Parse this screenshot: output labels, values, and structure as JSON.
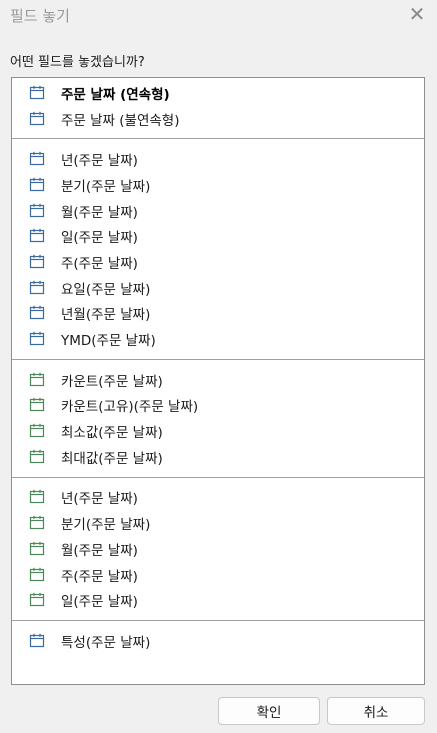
{
  "dialog": {
    "title": "필드 놓기",
    "prompt": "어떤 필드를 놓겠습니까?"
  },
  "colors": {
    "icon_blue": "#3a6b9e",
    "icon_green": "#4a8a5a",
    "bold_text": "#000000"
  },
  "groups": [
    {
      "items": [
        {
          "label": "주문 날짜 (연속형)",
          "icon": "calendar-icon",
          "icon_color": "blue",
          "bold": true
        },
        {
          "label": "주문 날짜 (불연속형)",
          "icon": "calendar-icon",
          "icon_color": "blue",
          "bold": false
        }
      ]
    },
    {
      "items": [
        {
          "label": "년(주문 날짜)",
          "icon": "calendar-icon",
          "icon_color": "blue"
        },
        {
          "label": "분기(주문 날짜)",
          "icon": "calendar-icon",
          "icon_color": "blue"
        },
        {
          "label": "월(주문 날짜)",
          "icon": "calendar-icon",
          "icon_color": "blue"
        },
        {
          "label": "일(주문 날짜)",
          "icon": "calendar-icon",
          "icon_color": "blue"
        },
        {
          "label": "주(주문 날짜)",
          "icon": "calendar-icon",
          "icon_color": "blue"
        },
        {
          "label": "요일(주문 날짜)",
          "icon": "calendar-icon",
          "icon_color": "blue"
        },
        {
          "label": "년월(주문 날짜)",
          "icon": "calendar-icon",
          "icon_color": "blue"
        },
        {
          "label": "YMD(주문 날짜)",
          "icon": "calendar-icon",
          "icon_color": "blue"
        }
      ]
    },
    {
      "items": [
        {
          "label": "카운트(주문 날짜)",
          "icon": "calendar-icon",
          "icon_color": "green"
        },
        {
          "label": "카운트(고유)(주문 날짜)",
          "icon": "calendar-icon",
          "icon_color": "green"
        },
        {
          "label": "최소값(주문 날짜)",
          "icon": "calendar-icon",
          "icon_color": "green"
        },
        {
          "label": "최대값(주문 날짜)",
          "icon": "calendar-icon",
          "icon_color": "green"
        }
      ]
    },
    {
      "items": [
        {
          "label": "년(주문 날짜)",
          "icon": "calendar-icon",
          "icon_color": "green"
        },
        {
          "label": "분기(주문 날짜)",
          "icon": "calendar-icon",
          "icon_color": "green"
        },
        {
          "label": "월(주문 날짜)",
          "icon": "calendar-icon",
          "icon_color": "green"
        },
        {
          "label": "주(주문 날짜)",
          "icon": "calendar-icon",
          "icon_color": "green"
        },
        {
          "label": "일(주문 날짜)",
          "icon": "calendar-icon",
          "icon_color": "green"
        }
      ]
    },
    {
      "items": [
        {
          "label": "특성(주문 날짜)",
          "icon": "calendar-icon",
          "icon_color": "blue"
        }
      ]
    }
  ],
  "buttons": {
    "ok_label": "확인",
    "cancel_label": "취소"
  }
}
